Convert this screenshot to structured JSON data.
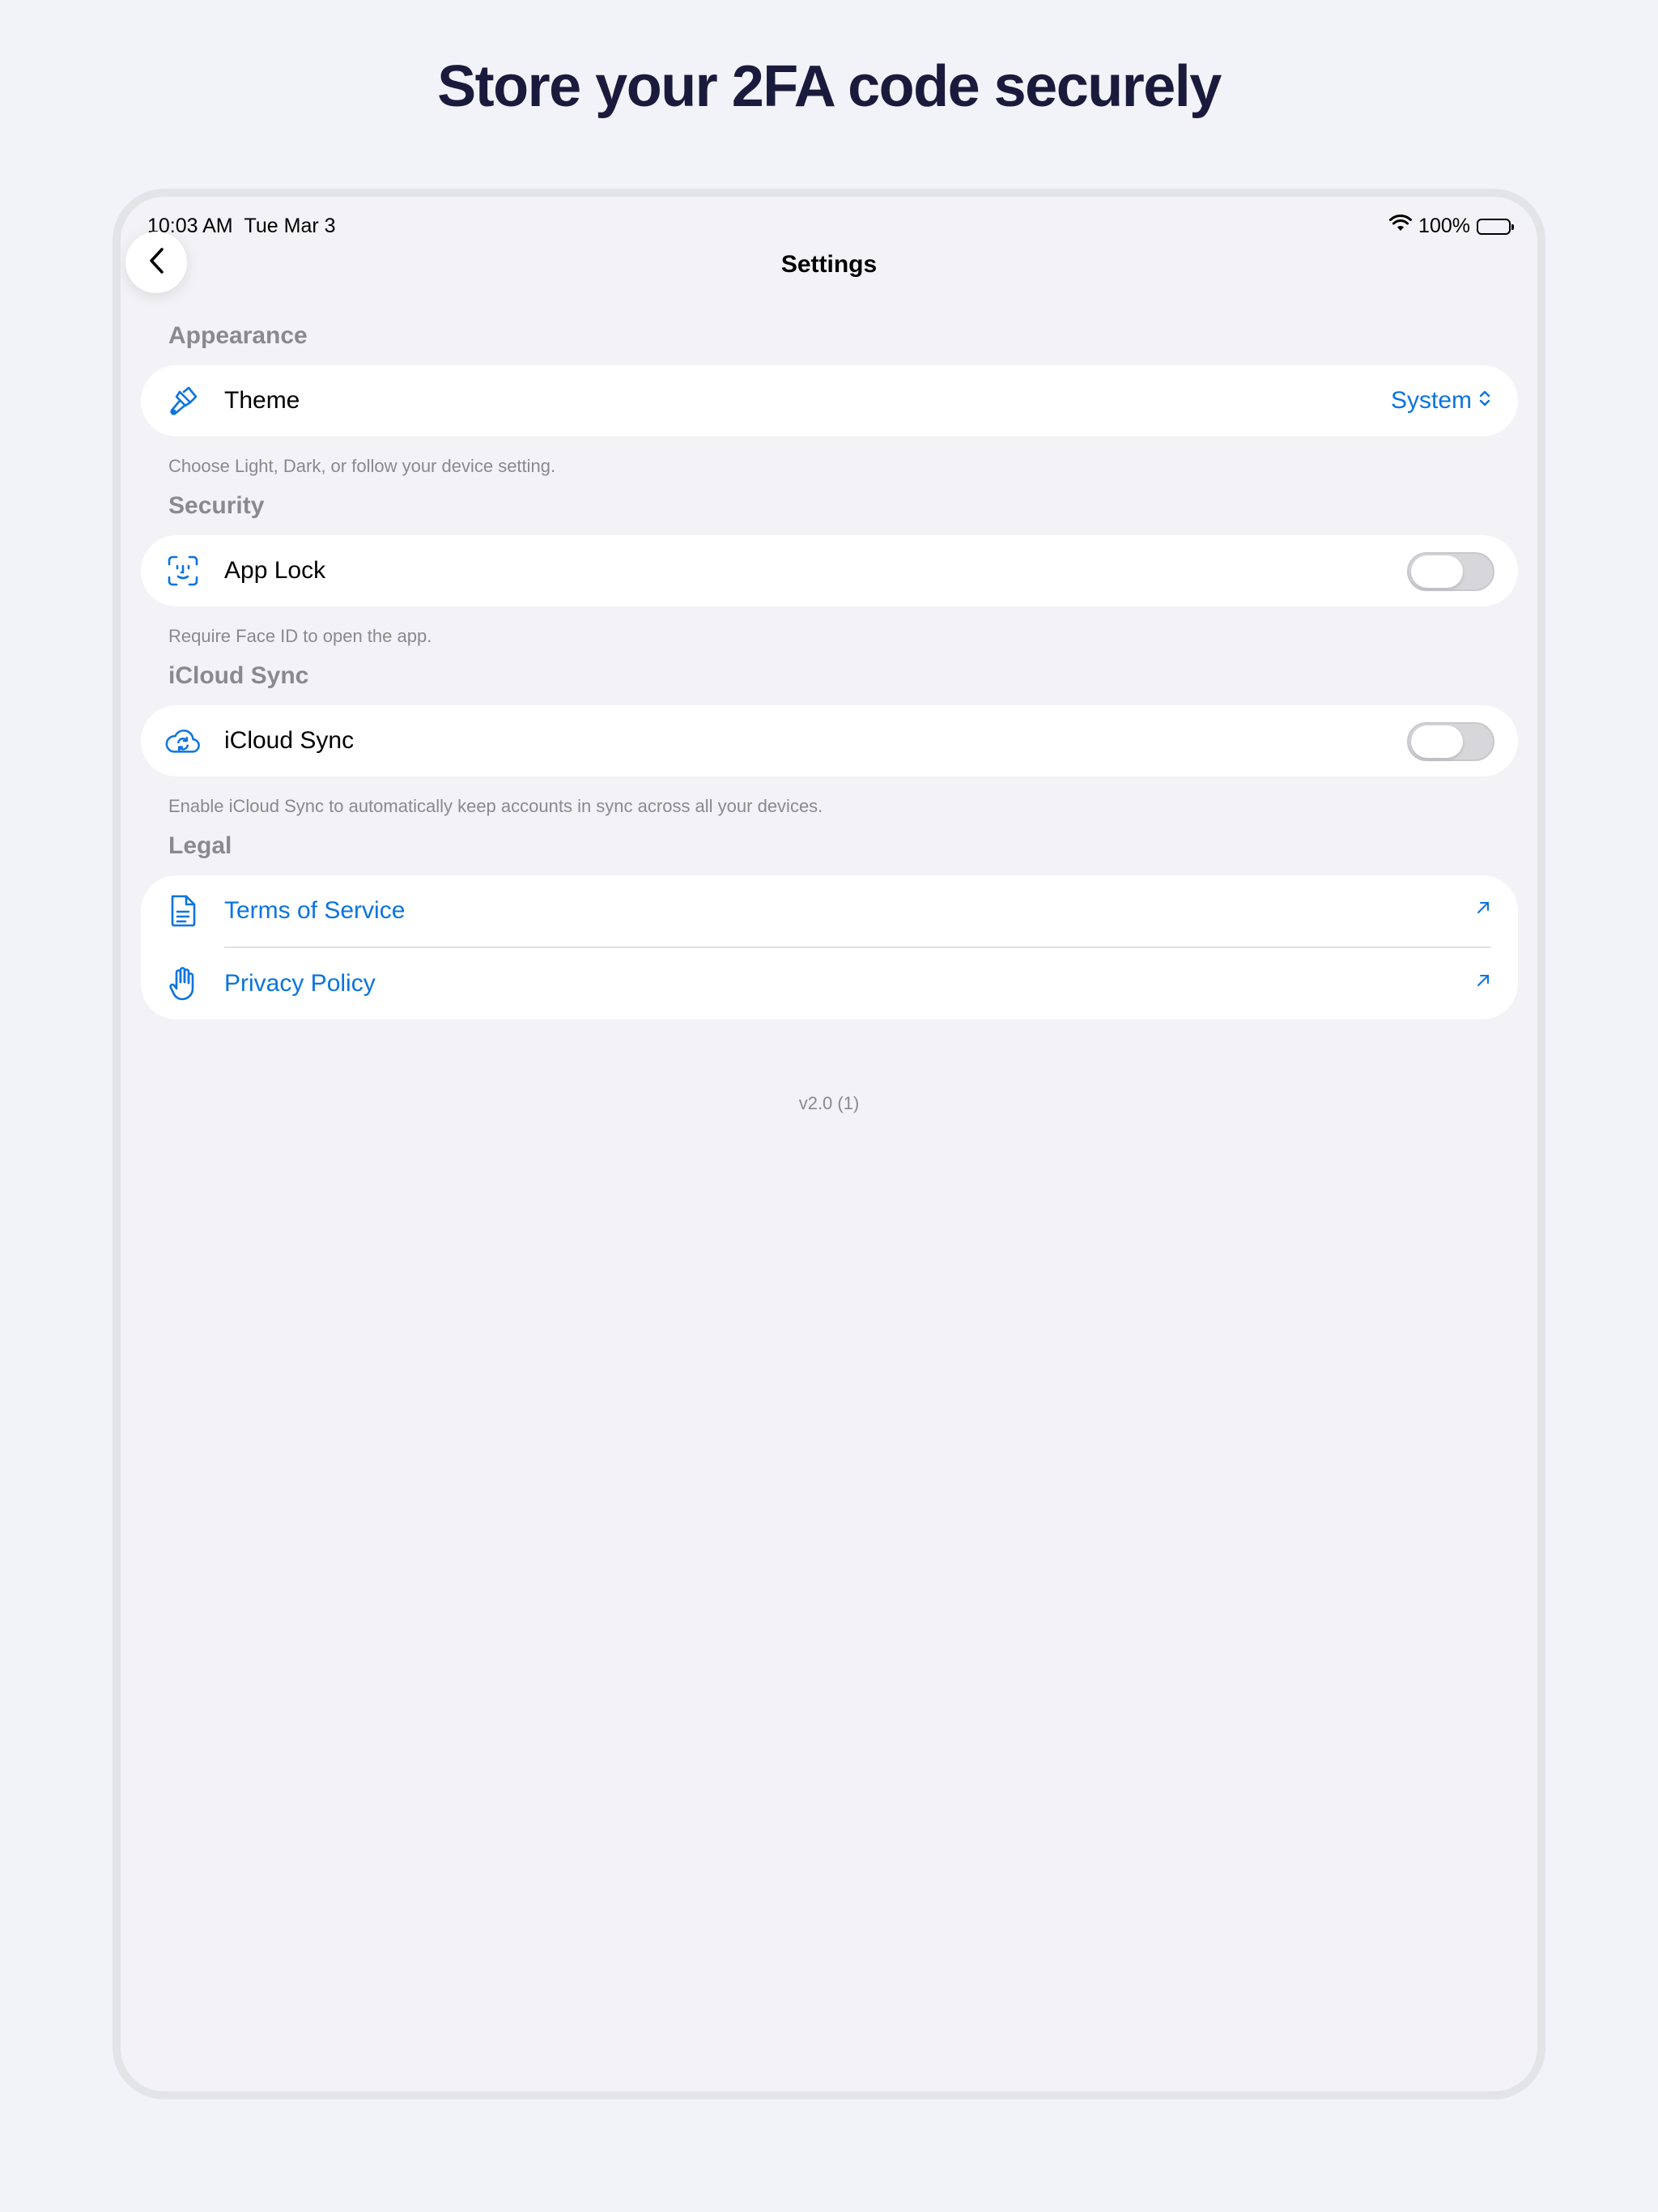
{
  "headline": "Store your 2FA code securely",
  "status": {
    "time": "10:03 AM",
    "date": "Tue Mar 3",
    "battery": "100%"
  },
  "nav": {
    "title": "Settings",
    "back_icon": "chevron-left-icon"
  },
  "sections": {
    "appearance": {
      "header": "Appearance",
      "theme_label": "Theme",
      "theme_value": "System",
      "footer": "Choose Light, Dark, or follow your device setting."
    },
    "security": {
      "header": "Security",
      "app_lock_label": "App Lock",
      "app_lock_on": false,
      "footer": "Require Face ID to open the app."
    },
    "icloud": {
      "header": "iCloud Sync",
      "sync_label": "iCloud Sync",
      "sync_on": false,
      "footer": "Enable iCloud Sync to automatically keep accounts in sync across all your devices."
    },
    "legal": {
      "header": "Legal",
      "terms_label": "Terms of Service",
      "privacy_label": "Privacy Policy"
    }
  },
  "version": "v2.0 (1)",
  "colors": {
    "accent": "#0a74e0",
    "background": "#f2f2f7",
    "headline": "#1a1b3c",
    "secondary_text": "#8a8a8e"
  }
}
